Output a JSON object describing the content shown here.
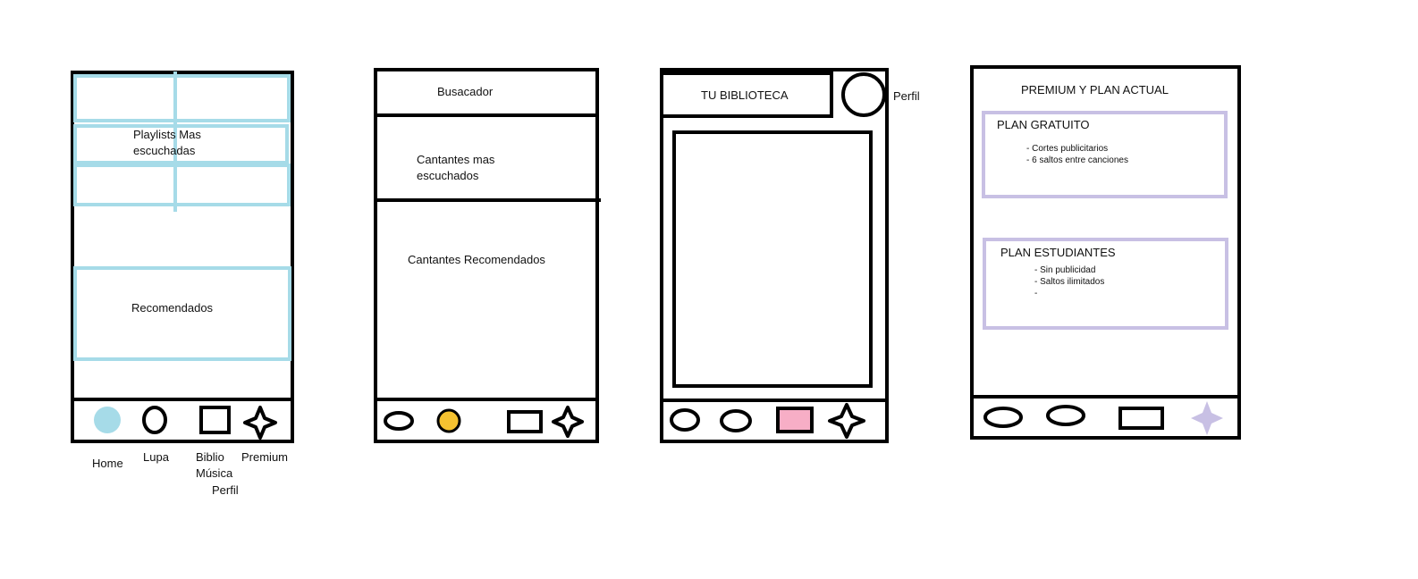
{
  "colors": {
    "outline": "#000000",
    "home_blue": "#a6dbe8",
    "lupa_yellow": "#f5c230",
    "biblio_pink": "#f7aec6",
    "premium_lavender": "#c8c0e4"
  },
  "screen1": {
    "playlists_label_line1": "Playlists Mas",
    "playlists_label_line2": "escuchadas",
    "recomendados_label": "Recomendados",
    "nav_labels": {
      "home": "Home",
      "lupa": "Lupa",
      "biblio_line1": "Biblio",
      "biblio_line2": "Música",
      "premium": "Premium",
      "perfil": "Perfil"
    },
    "nav_icons": [
      "circle-filled-blue-icon",
      "oval-icon",
      "square-icon",
      "star-icon"
    ]
  },
  "screen2": {
    "search_label": "Busacador",
    "top_singers_line1": "Cantantes mas",
    "top_singers_line2": "escuchados",
    "recommended_singers": "Cantantes Recomendados",
    "nav_icons": [
      "oval-icon",
      "circle-filled-yellow-icon",
      "rectangle-icon",
      "star-icon"
    ]
  },
  "screen3": {
    "library_title": "TU BIBLIOTECA",
    "profile_label": "Perfil",
    "nav_icons": [
      "oval-icon",
      "oval-icon",
      "rectangle-filled-pink-icon",
      "star-icon"
    ]
  },
  "screen4": {
    "title": "PREMIUM  Y PLAN ACTUAL",
    "plans": [
      {
        "name": "PLAN GRATUITO",
        "features": [
          "- Cortes publicitarios",
          "- 6 saltos entre canciones"
        ]
      },
      {
        "name": "PLAN ESTUDIANTES",
        "features": [
          "- Sin publicidad",
          "- Saltos ilimitados",
          "-"
        ]
      }
    ],
    "nav_icons": [
      "oval-icon",
      "oval-icon",
      "rectangle-icon",
      "star-filled-lavender-icon"
    ]
  }
}
